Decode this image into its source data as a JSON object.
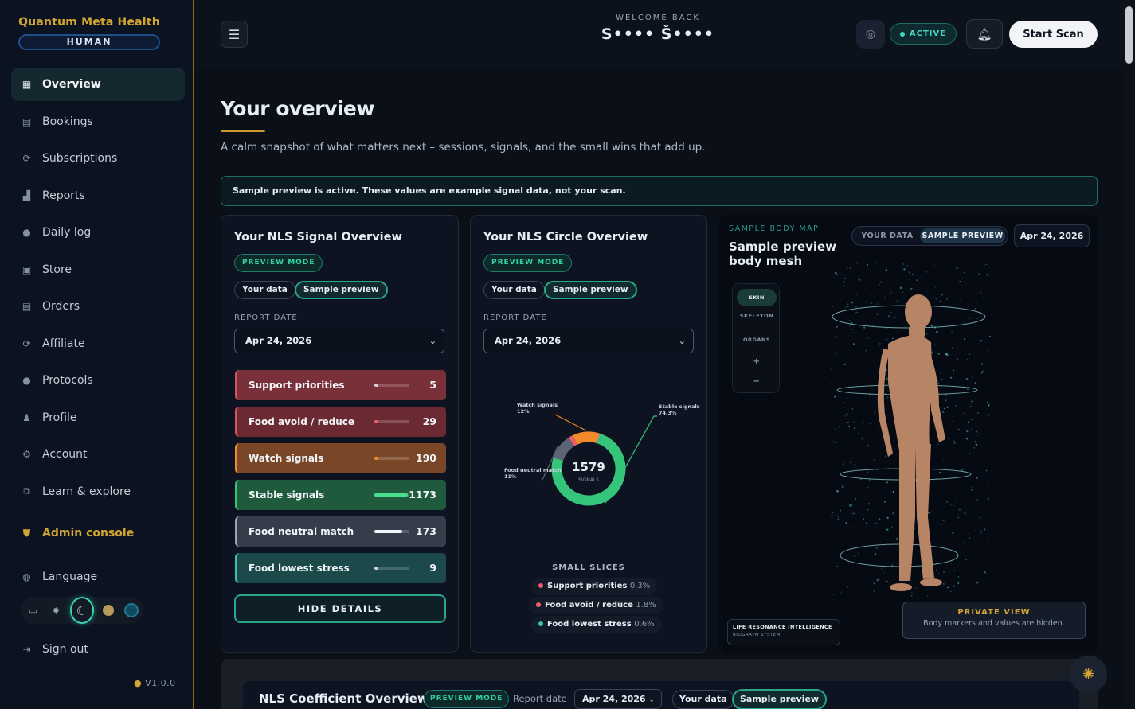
{
  "brand": {
    "name": "Quantum Meta Health",
    "mode": "HUMAN"
  },
  "sidebar": {
    "items": [
      {
        "label": "Overview",
        "icon": "grid-icon",
        "active": true
      },
      {
        "label": "Bookings",
        "icon": "calendar-icon"
      },
      {
        "label": "Subscriptions",
        "icon": "refresh-icon"
      },
      {
        "label": "Reports",
        "icon": "chart-icon"
      },
      {
        "label": "Daily log",
        "icon": "log-icon"
      },
      {
        "label": "Store",
        "icon": "bag-icon"
      },
      {
        "label": "Orders",
        "icon": "box-icon"
      },
      {
        "label": "Affiliate",
        "icon": "link-icon"
      },
      {
        "label": "Protocols",
        "icon": "protocol-icon"
      },
      {
        "label": "Profile",
        "icon": "user-icon"
      },
      {
        "label": "Account",
        "icon": "gear-icon"
      },
      {
        "label": "Learn & explore",
        "icon": "external-icon"
      }
    ],
    "admin": "Admin console",
    "language": "Language",
    "signout": "Sign out",
    "version": "V1.0.0"
  },
  "header": {
    "welcome": "WELCOME BACK",
    "name": "S•••• Š••••",
    "status": "ACTIVE",
    "start_scan": "Start Scan"
  },
  "main": {
    "title": "Your overview",
    "subtitle": "A calm snapshot of what matters next – sessions, signals, and the small wins that add up.",
    "banner": "Sample preview is active. These values are example signal data, not your scan."
  },
  "signal_card": {
    "title": "Your NLS Signal Overview",
    "badge": "PREVIEW MODE",
    "toggle_yours": "Your data",
    "toggle_sample": "Sample preview",
    "date_label": "REPORT DATE",
    "date": "Apr 24, 2026",
    "rows": [
      {
        "label": "Support priorities",
        "value": "5",
        "bg": "#7a3038",
        "border": "#d9505f",
        "bar": "#cfd4da",
        "fill": 0.0
      },
      {
        "label": "Food avoid / reduce",
        "value": "29",
        "bg": "#6b2a32",
        "border": "#d9505f",
        "bar": "#ef5d6a",
        "fill": 0.08
      },
      {
        "label": "Watch signals",
        "value": "190",
        "bg": "#7a4628",
        "border": "#f28a2c",
        "bar": "#f28a2c",
        "fill": 0.12
      },
      {
        "label": "Stable signals",
        "value": "1173",
        "bg": "#1f5a3c",
        "border": "#34c47a",
        "bar": "#46e08f",
        "fill": 0.95
      },
      {
        "label": "Food neutral match",
        "value": "173",
        "bg": "#353d4b",
        "border": "#9aa5b3",
        "bar": "#f1f4f8",
        "fill": 0.8
      },
      {
        "label": "Food lowest stress",
        "value": "9",
        "bg": "#1c4a4b",
        "border": "#38c2b1",
        "bar": "#cfd4da",
        "fill": 0.0
      }
    ],
    "hide_details": "HIDE DETAILS"
  },
  "circle_card": {
    "title": "Your NLS Circle Overview",
    "badge": "PREVIEW MODE",
    "toggle_yours": "Your data",
    "toggle_sample": "Sample preview",
    "date_label": "REPORT DATE",
    "date": "Apr 24, 2026",
    "small_slices": "SMALL SLICES",
    "legend": [
      {
        "label": "Support priorities",
        "pct": "0.3%",
        "color": "#ef5d6a"
      },
      {
        "label": "Food avoid / reduce",
        "pct": "1.8%",
        "color": "#ef5d6a"
      },
      {
        "label": "Food lowest stress",
        "pct": "0.6%",
        "color": "#38c2b1"
      }
    ]
  },
  "chart_data": {
    "type": "pie",
    "center_value": "1579",
    "center_label": "SIGNALS",
    "slices": [
      {
        "label": "Stable signals",
        "value": 74.3,
        "color": "#34c47a",
        "callout": "Stable signals 74.3%"
      },
      {
        "label": "Food neutral match",
        "value": 11.0,
        "color": "#5b6575",
        "callout": "Food neutral match 11%"
      },
      {
        "label": "Support priorities",
        "value": 0.3,
        "color": "#ef5d6a"
      },
      {
        "label": "Food avoid / reduce",
        "value": 1.8,
        "color": "#ef5d6a"
      },
      {
        "label": "Watch signals",
        "value": 12.0,
        "color": "#f28a2c",
        "callout": "Watch signals 12%"
      },
      {
        "label": "Food lowest stress",
        "value": 0.6,
        "color": "#38c2b1"
      }
    ]
  },
  "body_map": {
    "kicker": "SAMPLE BODY MAP",
    "title": "Sample preview body mesh",
    "toggle_yours": "YOUR DATA",
    "toggle_sample": "SAMPLE PREVIEW",
    "date": "Apr 24, 2026",
    "layers": [
      "SKIN",
      "SKELETON",
      "ORGANS",
      "+",
      "−"
    ],
    "lri_title": "LIFE RESONANCE INTELLIGENCE",
    "lri_sub": "BIOGRAPH SYSTEM",
    "private_title": "PRIVATE VIEW",
    "private_sub": "Body markers and values are hidden."
  },
  "coefficient": {
    "title": "NLS Coefficient Overview",
    "badge": "PREVIEW MODE",
    "date_label": "Report date",
    "date": "Apr 24, 2026",
    "toggle_yours": "Your data",
    "toggle_sample": "Sample preview"
  }
}
